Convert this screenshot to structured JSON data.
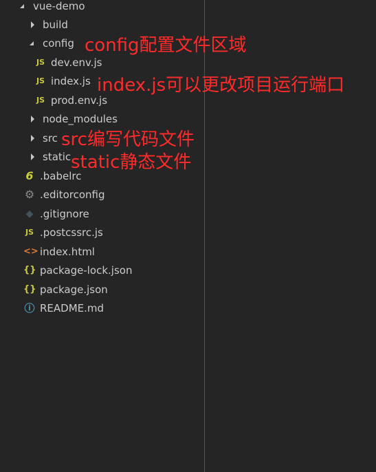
{
  "tree": {
    "root": "vue-demo",
    "build": "build",
    "config": "config",
    "dev_env": "dev.env.js",
    "index_js": "index.js",
    "prod_env": "prod.env.js",
    "node_modules": "node_modules",
    "src": "src",
    "static": "static",
    "babelrc": ".babelrc",
    "editorconfig": ".editorconfig",
    "gitignore": ".gitignore",
    "postcssrc": ".postcssrc.js",
    "index_html": "index.html",
    "package_lock": "package-lock.json",
    "package_json": "package.json",
    "readme": "README.md"
  },
  "icons": {
    "js": "JS",
    "babel": "6",
    "gear": "⚙",
    "git": "◆",
    "html": "<>",
    "json": "{}",
    "info": "ⓘ"
  },
  "annotations": {
    "config": "config配置文件区域",
    "index": "index.js可以更改项目运行端口",
    "src": "src编写代码文件",
    "static": "static静态文件"
  },
  "colors": {
    "background": "#252526",
    "text": "#cccccc",
    "annotation": "#ff2b2b",
    "js_icon": "#cbcb41",
    "html_icon": "#e37933",
    "info_icon": "#519aba"
  }
}
